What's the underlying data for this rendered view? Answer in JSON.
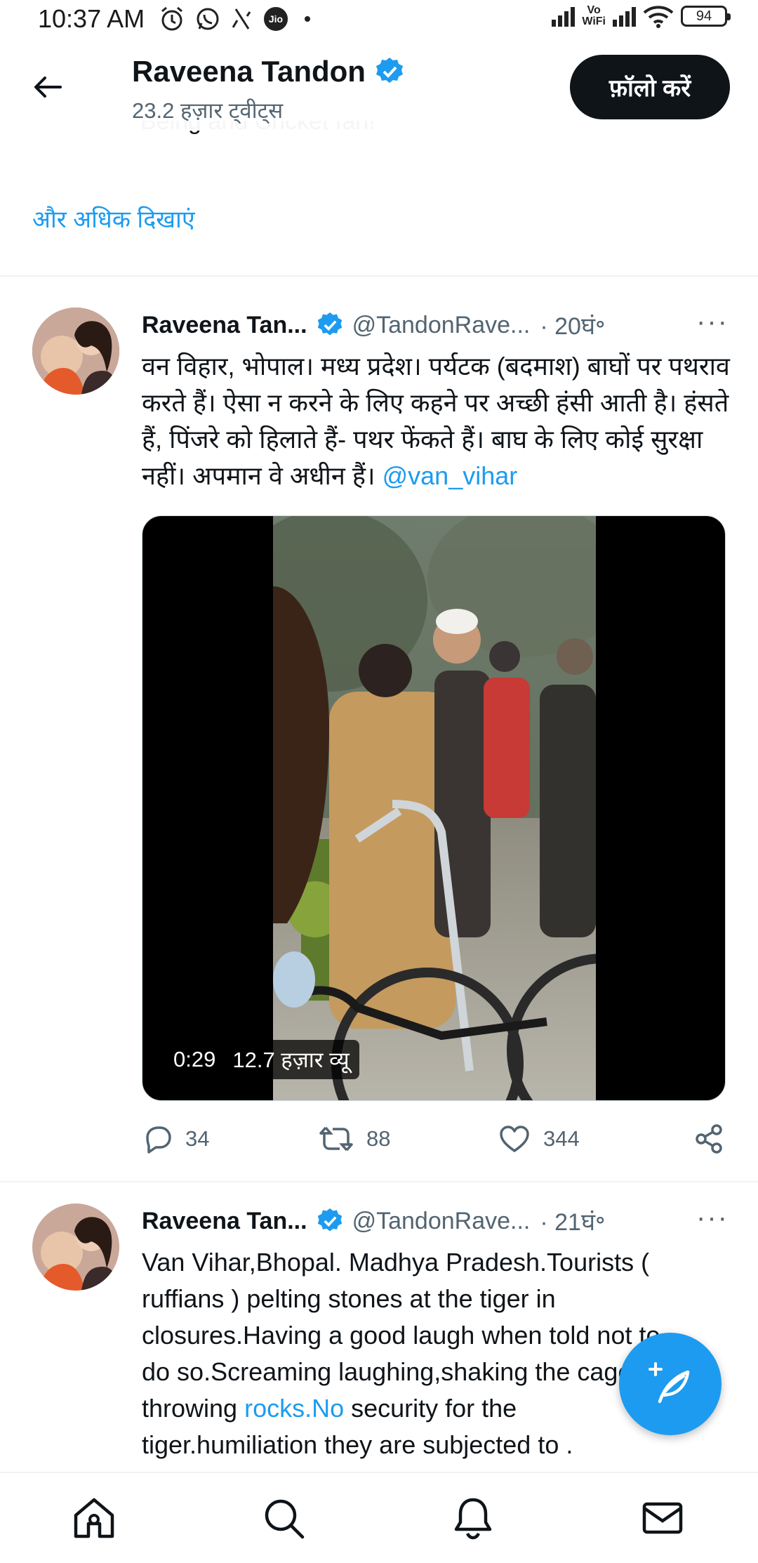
{
  "status_bar": {
    "time": "10:37 AM",
    "icons_left": [
      "alarm-icon",
      "whatsapp-icon",
      "signal-slash-icon",
      "jio-icon"
    ],
    "jio_label": "Jio",
    "vowifi_label_top": "Vo",
    "vowifi_label_bottom": "WiFi",
    "battery": "94"
  },
  "header": {
    "name": "Raveena Tandon",
    "tweet_count": "23.2 हज़ार ट्वीट्स",
    "follow_label": "फ़ॉलो करें",
    "cut_bio_text": "Being and Cricket fan!"
  },
  "show_more": "और अधिक दिखाएं",
  "tweets": [
    {
      "name": "Raveena Tan...",
      "handle": "@TandonRave...",
      "time": "· 20घं॰",
      "more": "···",
      "text": "वन विहार, भोपाल। मध्य प्रदेश। पर्यटक (बदमाश) बाघों पर पथराव करते हैं। ऐसा न करने के लिए कहने पर अच्छी हंसी आती है। हंसते हैं, पिंजरे को हिलाते हैं- पथर फेंकते हैं। बाघ के लिए कोई सुरक्षा नहीं। अपमान वे अधीन हैं।",
      "mention": "@van_vihar",
      "video": {
        "duration": "0:29",
        "views": "12.7 हज़ार व्यू"
      },
      "replies": "34",
      "retweets": "88",
      "likes": "344"
    },
    {
      "name": "Raveena Tan...",
      "handle": "@TandonRave...",
      "time": "· 21घं॰",
      "more": "···",
      "text_line1": "Van Vihar,Bhopal. Madhya Pradesh.Tourists (",
      "text_line2": "ruffians ) pelting stones at the tiger in",
      "text_line3": "closures.Having a good laugh when told not to",
      "text_line4": "do so.Screaming laughing,shaking the cage",
      "text_line5_pre": "throwing ",
      "text_line5_link": "rocks.No",
      "text_line5_post": " security for the",
      "text_line6": "tiger.humiliation they are subjected to ."
    }
  ],
  "colors": {
    "accent": "#1d9bf0",
    "text_primary": "#0f1419",
    "text_secondary": "#536471",
    "divider": "#eff3f4"
  },
  "bottom_nav": [
    "home-icon",
    "search-icon",
    "notifications-icon",
    "messages-icon"
  ]
}
